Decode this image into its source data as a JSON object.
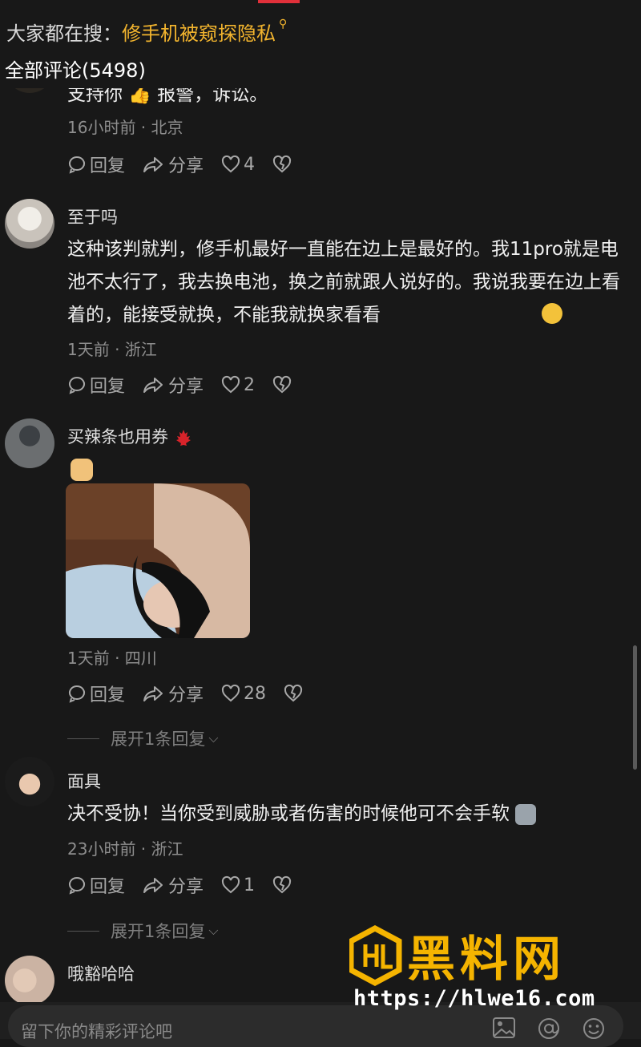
{
  "header": {
    "trending_prefix": "大家都在搜：",
    "trending_query": "修手机被窥探隐私",
    "all_comments": "全部评论(5498)"
  },
  "comments": [
    {
      "text": "支持你 👍 报警，诉讼。",
      "meta": "16小时前 · 北京",
      "reply": "回复",
      "share": "分享",
      "likes": "4"
    },
    {
      "username": "至于吗",
      "text": "这种该判就判，修手机最好一直能在边上是最好的。我11pro就是电池不太行了，我去换电池，换之前就跟人说好的。我说我要在边上看着的，能接受就换，不能我就换家看看",
      "meta": "1天前 · 浙江",
      "reply": "回复",
      "share": "分享",
      "likes": "2"
    },
    {
      "username": "买辣条也用券",
      "meta": "1天前 · 四川",
      "reply": "回复",
      "share": "分享",
      "likes": "28",
      "expand": "展开1条回复"
    },
    {
      "username": "面具",
      "text": "决不受协！当你受到威胁或者伤害的时候他可不会手软",
      "meta": "23小时前 · 浙江",
      "reply": "回复",
      "share": "分享",
      "likes": "1",
      "expand": "展开1条回复"
    },
    {
      "username": "哦豁哈哈"
    }
  ],
  "input": {
    "placeholder": "留下你的精彩评论吧"
  },
  "watermark": {
    "name": "黑料网",
    "url": "https://hlwe16.com"
  },
  "icons": [
    "search-icon",
    "comment-icon",
    "share-icon",
    "heart-icon",
    "broken-heart-icon",
    "image-icon",
    "at-icon",
    "emoji-icon"
  ],
  "colors": {
    "background": "#181818",
    "accent": "#f2b42e",
    "tab_indicator": "#e0303a"
  }
}
